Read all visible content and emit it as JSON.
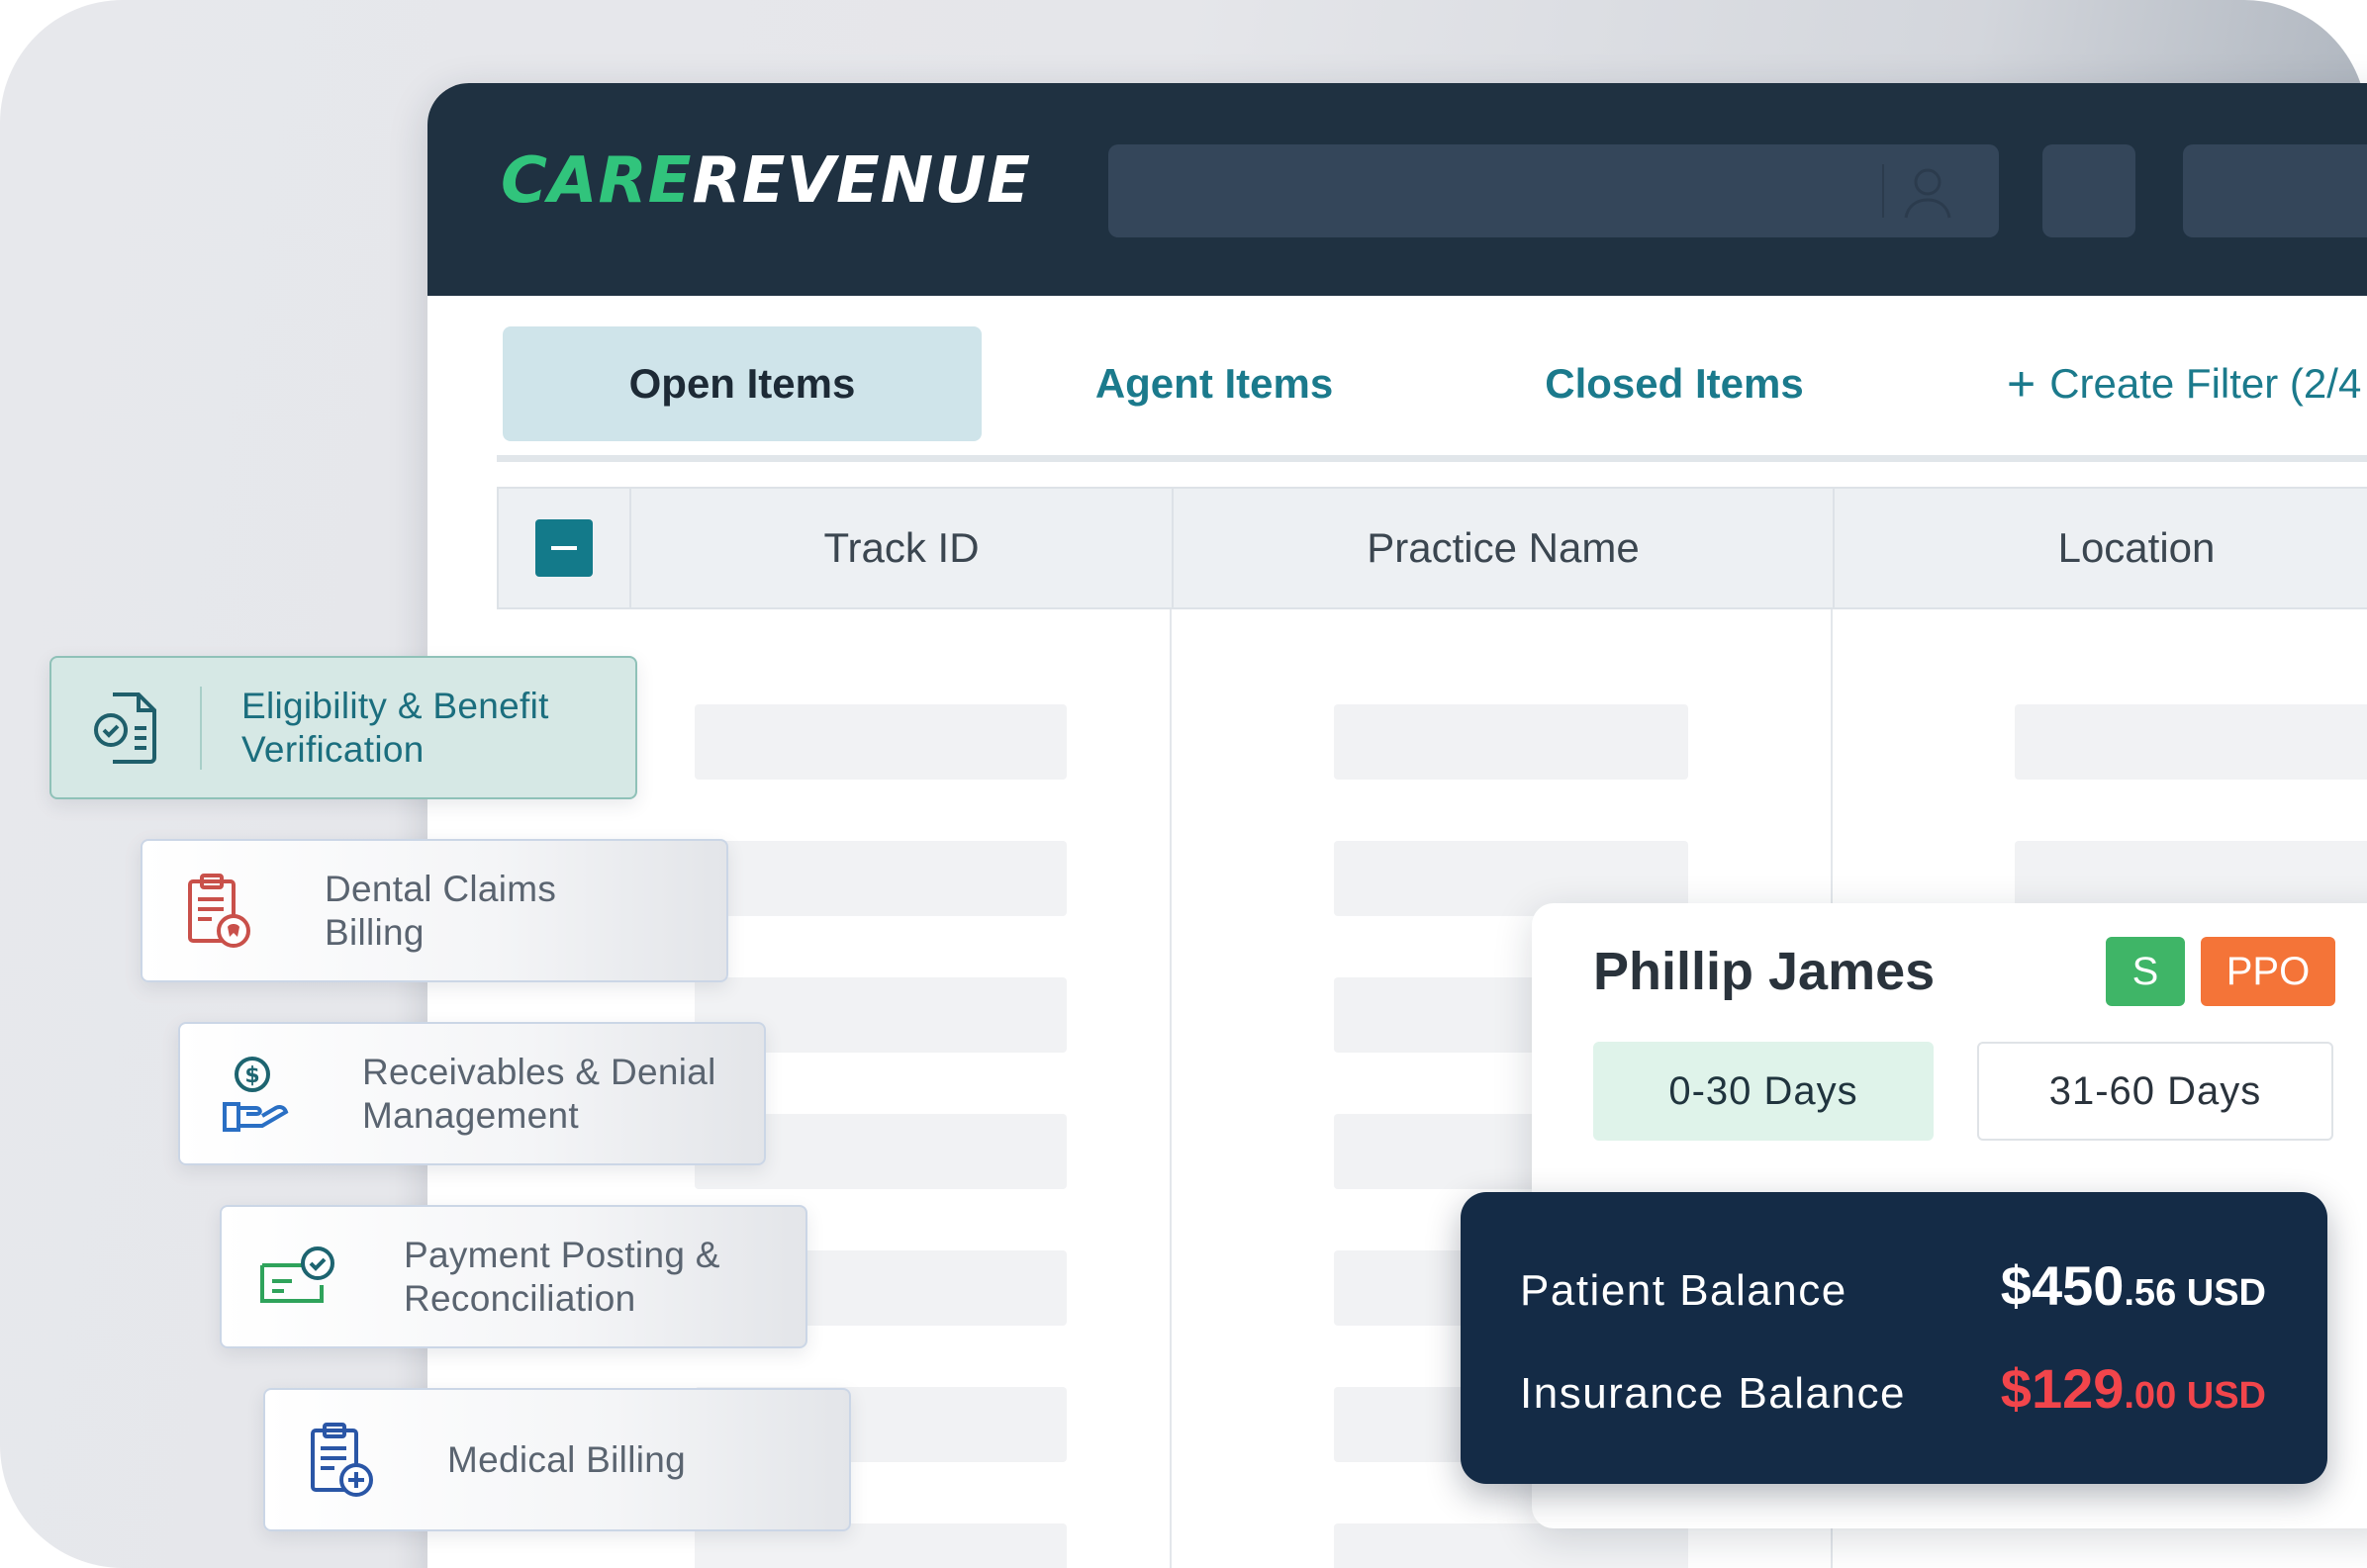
{
  "app": {
    "logo": {
      "part1": "CARE",
      "part2": "REVENUE"
    },
    "topbar": {
      "search_icon": "user-icon"
    }
  },
  "tabs": [
    {
      "label": "Open Items",
      "active": true
    },
    {
      "label": "Agent Items",
      "active": false
    },
    {
      "label": "Closed Items",
      "active": false
    }
  ],
  "create_filter": {
    "icon": "plus-icon",
    "label": "Create Filter (2/4"
  },
  "table": {
    "columns": [
      "Track ID",
      "Practice Name",
      "Location"
    ]
  },
  "services": [
    {
      "icon": "eligibility-verification-icon",
      "label_line1": "Eligibility & Benefit",
      "label_line2": "Verification",
      "active": true
    },
    {
      "icon": "dental-claims-icon",
      "label_line1": "Dental Claims",
      "label_line2": "Billing",
      "active": false
    },
    {
      "icon": "receivables-hand-icon",
      "label_line1": "Receivables & Denial",
      "label_line2": "Management",
      "active": false
    },
    {
      "icon": "payment-posting-icon",
      "label_line1": "Payment Posting &",
      "label_line2": "Reconciliation",
      "active": false
    },
    {
      "icon": "medical-billing-icon",
      "label_line1": "Medical Billing",
      "label_line2": "",
      "active": false
    }
  ],
  "patient": {
    "name": "Phillip James",
    "badges": [
      "S",
      "PPO"
    ],
    "days": [
      "0-30 Days",
      "31-60 Days"
    ],
    "patient_balance": {
      "label": "Patient Balance",
      "whole": "$450",
      "cents": ".56 USD"
    },
    "insurance_balance": {
      "label": "Insurance Balance",
      "whole": "$129",
      "cents": ".00 USD"
    }
  },
  "colors": {
    "topbar": "#1f3141",
    "brand_green": "#31c47c",
    "teal": "#1b7a8c",
    "badge_s": "#3fb567",
    "badge_ppo": "#f47438",
    "balance_panel": "#142b46",
    "insurance_red": "#f2454b"
  }
}
